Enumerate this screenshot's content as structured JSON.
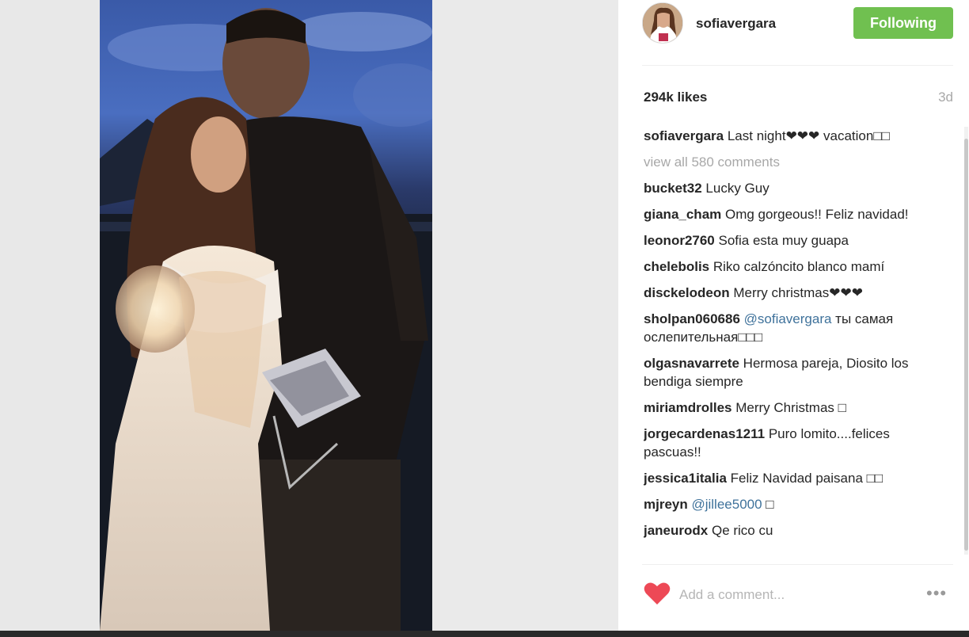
{
  "post": {
    "username": "sofiavergara",
    "follow_label": "Following",
    "likes": "294k likes",
    "age": "3d",
    "view_all": "view all 580 comments",
    "add_comment_placeholder": "Add a comment...",
    "more_label": "•••",
    "comments": [
      {
        "user": "sofiavergara",
        "text": " Last night❤❤❤ vacation□□"
      },
      {
        "user": "bucket32",
        "text": " Lucky Guy"
      },
      {
        "user": "giana_cham",
        "text": " Omg gorgeous!! Feliz navidad!"
      },
      {
        "user": "leonor2760",
        "text": " Sofia esta muy guapa"
      },
      {
        "user": "chelebolis",
        "text": " Riko calzóncito blanco mamí"
      },
      {
        "user": "disckelodeon",
        "text": " Merry christmas❤❤❤"
      },
      {
        "user": "sholpan060686",
        "mention": " @sofiavergara",
        "text": " ты самая ослепительная□□□"
      },
      {
        "user": "olgasnavarrete",
        "text": " Hermosa pareja, Diosito los bendiga siempre"
      },
      {
        "user": "miriamdrolles",
        "text": " Merry Christmas □"
      },
      {
        "user": "jorgecardenas1211",
        "text": " Puro lomito....felices pascuas!!"
      },
      {
        "user": "jessica1italia",
        "text": " Feliz Navidad paisana □□"
      },
      {
        "user": "mjreyn",
        "mention": " @jillee5000",
        "text": " □"
      },
      {
        "user": "janeurodx",
        "text": " Qe rico cu"
      }
    ]
  },
  "colors": {
    "follow_green": "#70c050",
    "heart_red": "#ed4956",
    "mention_blue": "#3f729b"
  },
  "icons": {
    "like": "heart-icon",
    "more": "more-options-icon"
  }
}
